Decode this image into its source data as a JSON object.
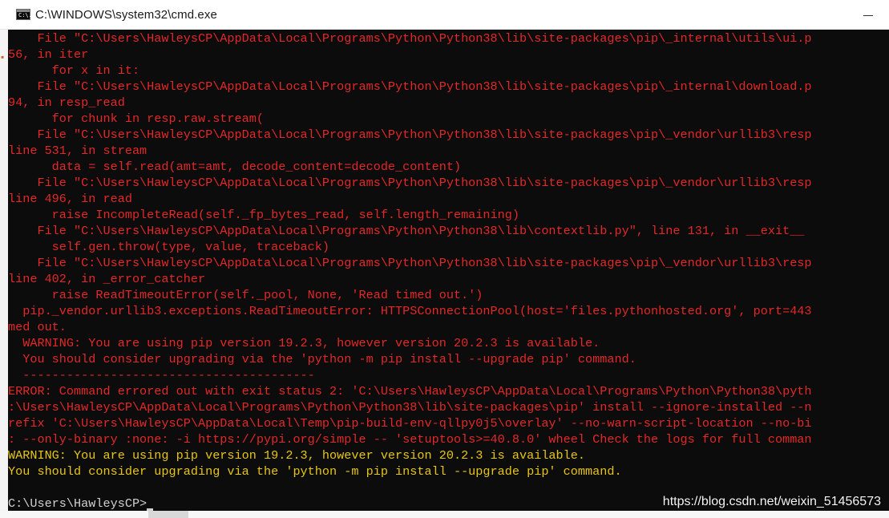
{
  "window": {
    "title": "C:\\WINDOWS\\system32\\cmd.exe",
    "icon": "cmd-window-icon",
    "icon_text": "C:\\."
  },
  "console": {
    "lines": [
      {
        "text": "    File \"C:\\Users\\HawleysCP\\AppData\\Local\\Programs\\Python\\Python38\\lib\\site-packages\\pip\\_internal\\utils\\ui.p",
        "kind": "err"
      },
      {
        "text": "56, in iter",
        "kind": "err"
      },
      {
        "text": "      for x in it:",
        "kind": "err"
      },
      {
        "text": "    File \"C:\\Users\\HawleysCP\\AppData\\Local\\Programs\\Python\\Python38\\lib\\site-packages\\pip\\_internal\\download.p",
        "kind": "err"
      },
      {
        "text": "94, in resp_read",
        "kind": "err"
      },
      {
        "text": "      for chunk in resp.raw.stream(",
        "kind": "err"
      },
      {
        "text": "    File \"C:\\Users\\HawleysCP\\AppData\\Local\\Programs\\Python\\Python38\\lib\\site-packages\\pip\\_vendor\\urllib3\\resp",
        "kind": "err"
      },
      {
        "text": "line 531, in stream",
        "kind": "err"
      },
      {
        "text": "      data = self.read(amt=amt, decode_content=decode_content)",
        "kind": "err"
      },
      {
        "text": "    File \"C:\\Users\\HawleysCP\\AppData\\Local\\Programs\\Python\\Python38\\lib\\site-packages\\pip\\_vendor\\urllib3\\resp",
        "kind": "err"
      },
      {
        "text": "line 496, in read",
        "kind": "err"
      },
      {
        "text": "      raise IncompleteRead(self._fp_bytes_read, self.length_remaining)",
        "kind": "err"
      },
      {
        "text": "    File \"C:\\Users\\HawleysCP\\AppData\\Local\\Programs\\Python\\Python38\\lib\\contextlib.py\", line 131, in __exit__",
        "kind": "err"
      },
      {
        "text": "      self.gen.throw(type, value, traceback)",
        "kind": "err"
      },
      {
        "text": "    File \"C:\\Users\\HawleysCP\\AppData\\Local\\Programs\\Python\\Python38\\lib\\site-packages\\pip\\_vendor\\urllib3\\resp",
        "kind": "err"
      },
      {
        "text": "line 402, in _error_catcher",
        "kind": "err"
      },
      {
        "text": "      raise ReadTimeoutError(self._pool, None, 'Read timed out.')",
        "kind": "err"
      },
      {
        "text": "  pip._vendor.urllib3.exceptions.ReadTimeoutError: HTTPSConnectionPool(host='files.pythonhosted.org', port=443",
        "kind": "err"
      },
      {
        "text": "med out.",
        "kind": "err"
      },
      {
        "text": "  WARNING: You are using pip version 19.2.3, however version 20.2.3 is available.",
        "kind": "err"
      },
      {
        "text": "  You should consider upgrading via the 'python -m pip install --upgrade pip' command.",
        "kind": "err"
      },
      {
        "text": "  ----------------------------------------",
        "kind": "err"
      },
      {
        "text": "ERROR: Command errored out with exit status 2: 'C:\\Users\\HawleysCP\\AppData\\Local\\Programs\\Python\\Python38\\pyth",
        "kind": "err"
      },
      {
        "text": ":\\Users\\HawleysCP\\AppData\\Local\\Programs\\Python\\Python38\\lib\\site-packages\\pip' install --ignore-installed --n",
        "kind": "err"
      },
      {
        "text": "refix 'C:\\Users\\HawleysCP\\AppData\\Local\\Temp\\pip-build-env-qllpy0j5\\overlay' --no-warn-script-location --no-bi",
        "kind": "err"
      },
      {
        "text": ": --only-binary :none: -i https://pypi.org/simple -- 'setuptools>=40.8.0' wheel Check the logs for full comman",
        "kind": "err"
      },
      {
        "text": "WARNING: You are using pip version 19.2.3, however version 20.2.3 is available.",
        "kind": "warn"
      },
      {
        "text": "You should consider upgrading via the 'python -m pip install --upgrade pip' command.",
        "kind": "warn"
      },
      {
        "text": "",
        "kind": "plain"
      },
      {
        "text": "C:\\Users\\HawleysCP>",
        "kind": "plain"
      }
    ]
  },
  "watermark": "https://blog.csdn.net/weixin_51456573",
  "colors": {
    "background": "#0c0c0c",
    "error_text": "#e22828",
    "warning_text": "#e7c514",
    "prompt_text": "#d0d0d0"
  }
}
